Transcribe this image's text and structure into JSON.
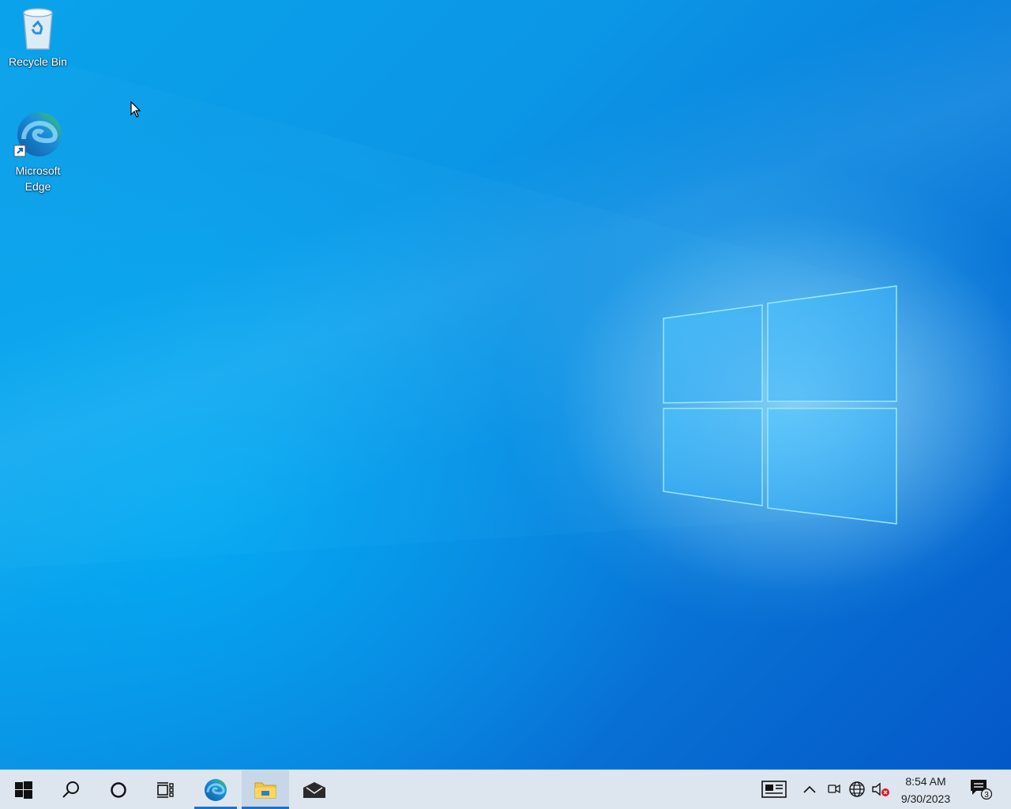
{
  "desktop": {
    "icons": [
      {
        "name": "recycle-bin",
        "label": "Recycle Bin",
        "icon": "recycle-bin-icon"
      },
      {
        "name": "microsoft-edge",
        "label": "Microsoft Edge",
        "icon": "edge-icon",
        "shortcut": true
      }
    ]
  },
  "taskbar": {
    "start": {
      "icon": "windows-start-icon"
    },
    "search": {
      "icon": "search-icon"
    },
    "cortana": {
      "icon": "cortana-circle-icon"
    },
    "task_view": {
      "icon": "task-view-icon"
    },
    "pinned": [
      {
        "name": "edge",
        "icon": "edge-icon",
        "running": true
      },
      {
        "name": "file-explorer",
        "icon": "folder-icon",
        "running": true,
        "active": true
      },
      {
        "name": "mail",
        "icon": "mail-icon",
        "running": false
      }
    ],
    "tray": {
      "news_icon": "news-widget-icon",
      "show_hidden_icon": "chevron-up-icon",
      "meet_now_icon": "meet-now-icon",
      "network_icon": "globe-network-icon",
      "volume_icon": "volume-muted-icon",
      "time": "8:54 AM",
      "date": "9/30/2023",
      "notifications_count": "3"
    }
  },
  "colors": {
    "taskbar_bg": "#dde6ef",
    "accent": "#1a73c9",
    "wallpaper_primary": "#0b96e6"
  }
}
